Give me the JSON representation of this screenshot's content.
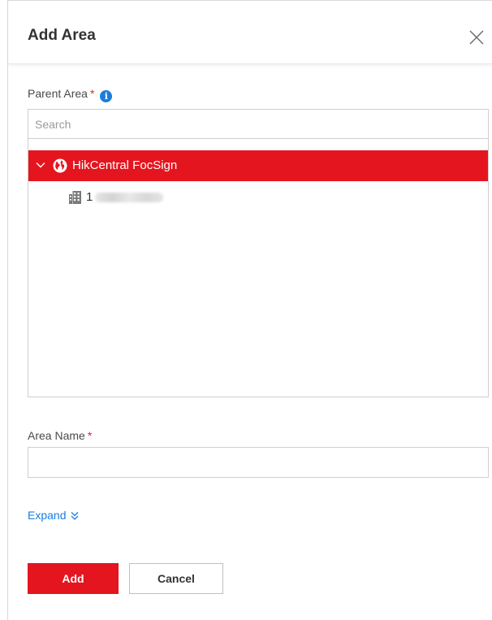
{
  "dialog": {
    "title": "Add Area",
    "close_icon": "close-icon"
  },
  "parent_area": {
    "label": "Parent Area",
    "required_mark": "*",
    "info_icon": "info-icon",
    "info_glyph": "i",
    "search_placeholder": "Search",
    "tree": [
      {
        "label": "HikCentral FocSign",
        "icon": "globe-icon",
        "expanded": true,
        "selected": true
      },
      {
        "label": "1",
        "icon": "building-icon",
        "selected": false
      }
    ]
  },
  "area_name": {
    "label": "Area Name",
    "required_mark": "*",
    "value": ""
  },
  "expand": {
    "label": "Expand",
    "icon": "double-chevron-down-icon"
  },
  "buttons": {
    "add_label": "Add",
    "cancel_label": "Cancel"
  },
  "colors": {
    "accent_red": "#e4151f",
    "link_blue": "#1a7dde",
    "required_red": "#e3212f"
  }
}
